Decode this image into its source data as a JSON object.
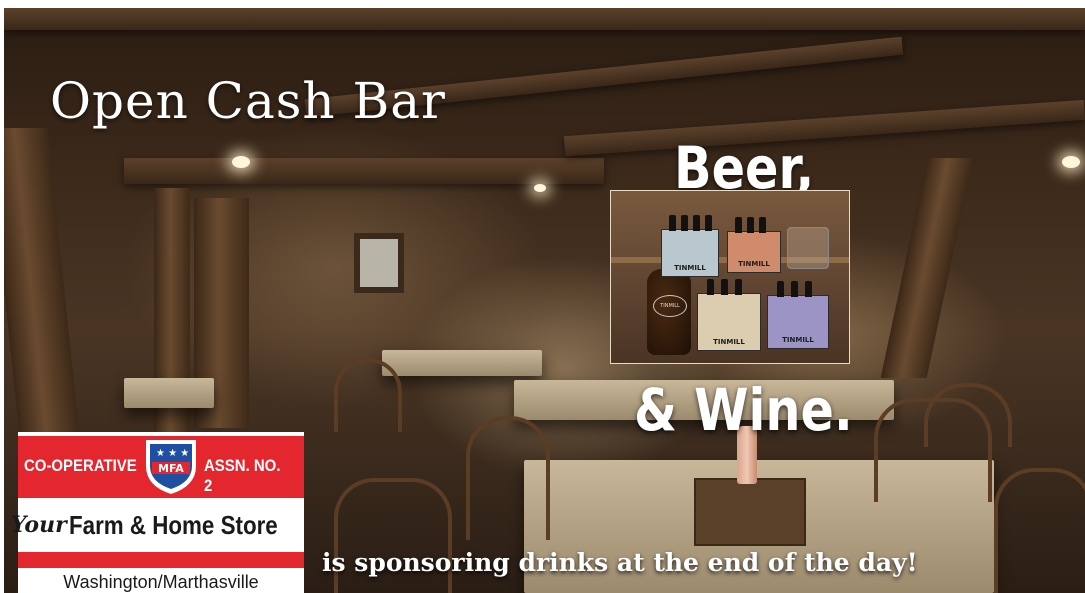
{
  "slide": {
    "title": "Open Cash Bar",
    "beer_text": "Beer,",
    "wine_text": "& Wine.",
    "sponsor_text": "is sponsoring drinks at the end of the day!"
  },
  "photo": {
    "brand": "TINMILL"
  },
  "logo": {
    "left_text": "CO-OPERATIVE",
    "right_text": "ASSN. NO. 2",
    "shield_text": "MFA",
    "your_text": "Your",
    "store_text": "Farm & Home Store",
    "location": "Washington/Marthasville"
  },
  "colors": {
    "logo_red": "#e4262f",
    "shield_blue": "#1f4fa3",
    "text_white": "#ffffff"
  }
}
